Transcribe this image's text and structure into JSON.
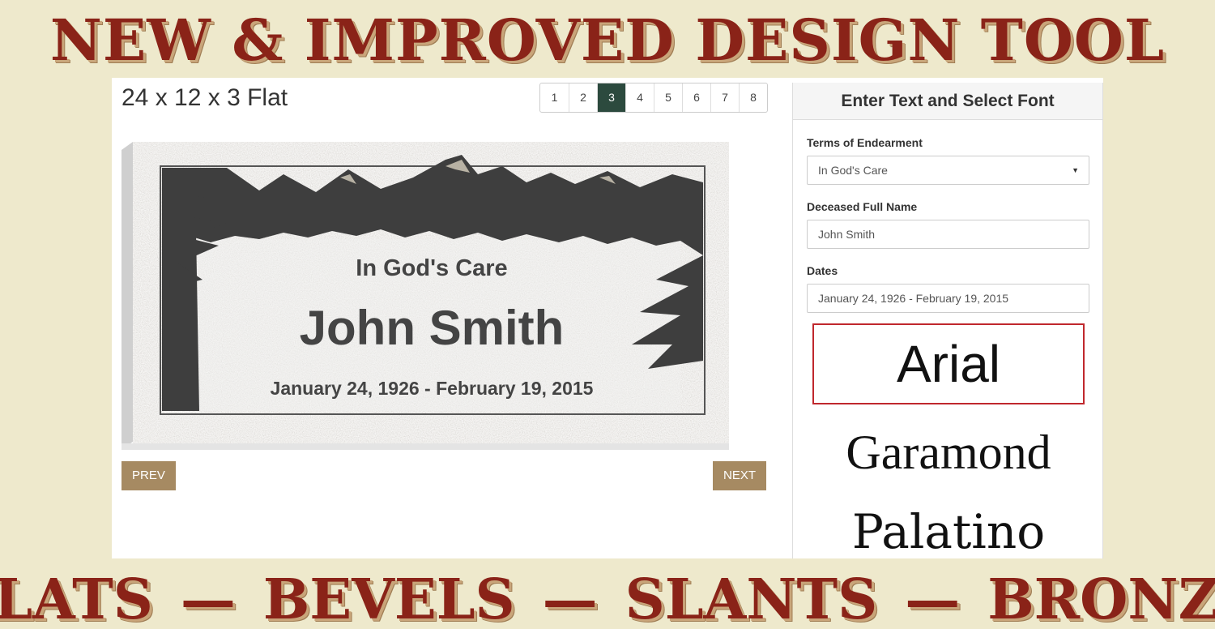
{
  "banner": {
    "top": "NEW & IMPROVED DESIGN TOOL",
    "bottom": [
      "FLATS",
      "—",
      "BEVELS",
      "—",
      "SLANTS",
      "—",
      "BRONZE"
    ]
  },
  "product": {
    "title": "24 x 12 x 3 Flat"
  },
  "pager": {
    "pages": [
      "1",
      "2",
      "3",
      "4",
      "5",
      "6",
      "7",
      "8"
    ],
    "active_page": "3"
  },
  "stone": {
    "line1": "In God's Care",
    "line2": "John Smith",
    "line3": "January 24, 1926 - February 19, 2015"
  },
  "nav": {
    "prev": "PREV",
    "next": "NEXT"
  },
  "panel": {
    "heading": "Enter Text and Select Font",
    "terms_label": "Terms of Endearment",
    "terms_value": "In God's Care",
    "name_label": "Deceased Full Name",
    "name_value": "John Smith",
    "dates_label": "Dates",
    "dates_value": "January 24, 1926 - February 19, 2015",
    "fonts": [
      "Arial",
      "Garamond",
      "Palatino"
    ],
    "selected_font": "Arial"
  },
  "colors": {
    "banner_text": "#8a2318",
    "background": "#eee9cc",
    "button": "#a68a62",
    "pager_active": "#2c4a3e",
    "font_selected_border": "#c0282d",
    "engraving": "#3e3e3e"
  }
}
